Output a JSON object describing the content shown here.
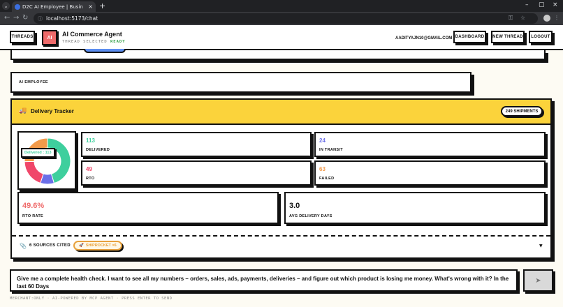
{
  "browser": {
    "tab_title": "D2C AI Employee | Busin",
    "url": "localhost:5173/chat"
  },
  "header": {
    "threads_label": "THREADS",
    "ai_badge": "AI",
    "title": "AI Commerce Agent",
    "thread_status_prefix": "THREAD SELECTED",
    "thread_status": "READY",
    "email": "AADITYAJN10@GMAIL.COM",
    "dashboard_label": "DASHBOARD",
    "new_thread_label": "NEW THREAD",
    "logout_label": "LOGOUT"
  },
  "ai_employee": {
    "label": "AI EMPLOYEE"
  },
  "tracker": {
    "title": "Delivery Tracker",
    "badge": "249 SHIPMENTS",
    "tooltip": "Delivered : 113",
    "stats": {
      "delivered": {
        "value": "113",
        "label": "DELIVERED",
        "color": "#3ecf9d"
      },
      "in_transit": {
        "value": "24",
        "label": "IN TRANSIT",
        "color": "#6b6fe8"
      },
      "rto": {
        "value": "49",
        "label": "RTO",
        "color": "#f0476a"
      },
      "failed": {
        "value": "63",
        "label": "FAILED",
        "color": "#f39a4a"
      },
      "rto_rate": {
        "value": "49.6%",
        "label": "RTO RATE",
        "color": "#ef6b6b"
      },
      "avg_days": {
        "value": "3.0",
        "label": "AVG DELIVERY DAYS",
        "color": "#111111"
      }
    },
    "sources_label": "6 SOURCES CITED",
    "source_chip": "SHIPROCKET ×6"
  },
  "chart_data": {
    "type": "pie",
    "categories": [
      "Delivered",
      "In Transit",
      "RTO",
      "Failed"
    ],
    "values": [
      113,
      24,
      49,
      63
    ],
    "colors": [
      "#3ecf9d",
      "#6b6fe8",
      "#f0476a",
      "#f39a4a"
    ]
  },
  "composer": {
    "text": "Give me a complete health check. I want to see all my numbers – orders, sales, ads, payments, deliveries – and figure out which product is losing me money. What's wrong with it? In the last 60 Days"
  },
  "footer": "MERCHANT:ONLY · AI-POWERED BY MCP AGENT · PRESS ENTER TO SEND"
}
